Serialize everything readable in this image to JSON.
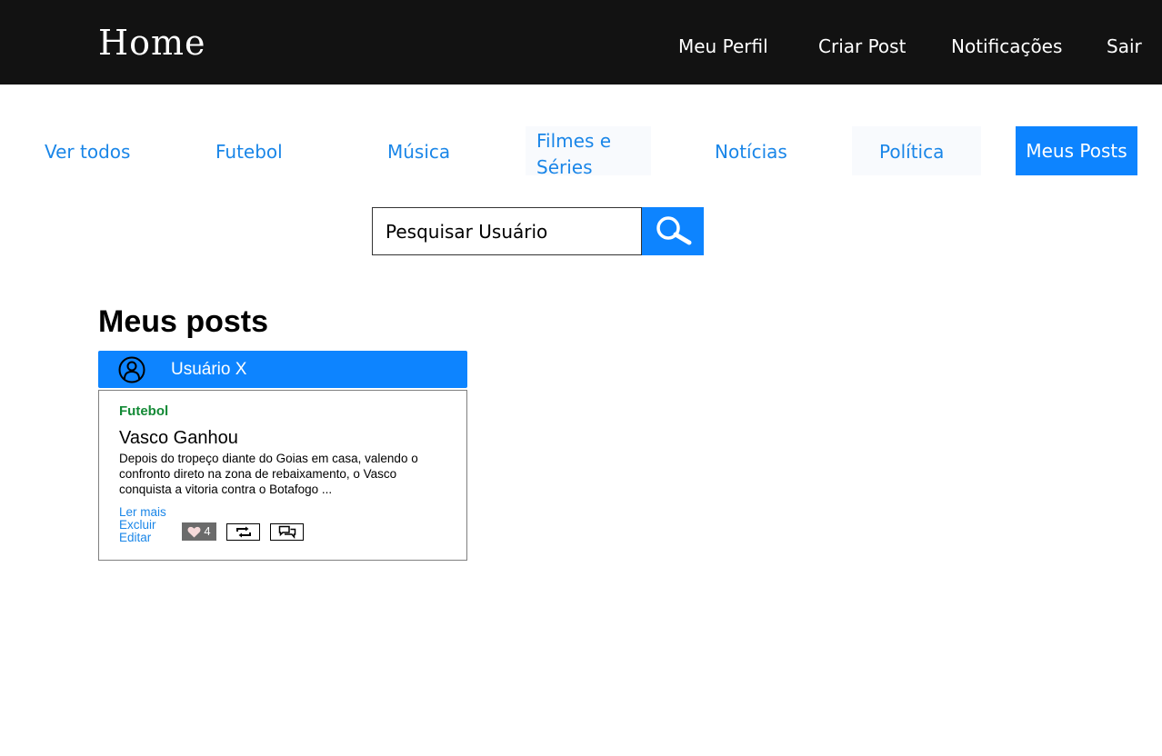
{
  "header": {
    "brand": "Home",
    "nav": [
      "Meu Perfil",
      "Criar Post",
      "Notificações",
      "Sair"
    ]
  },
  "categories": {
    "items": [
      "Ver todos",
      "Futebol",
      "Música",
      "Filmes e Séries",
      "Notícias",
      "Política",
      "Meus Posts"
    ],
    "active": "Meus Posts"
  },
  "search": {
    "placeholder": "Pesquisar Usuário"
  },
  "section": {
    "title": "Meus posts"
  },
  "post": {
    "author": "Usuário X",
    "category": "Futebol",
    "title": "Vasco Ganhou",
    "excerpt": "Depois do tropeço diante do Goias em casa, valendo o confronto direto na zona de rebaixamento, o Vasco conquista a vitoria contra o Botafogo ...",
    "actions": {
      "read_more": "Ler mais",
      "delete": "Excluir",
      "edit": "Editar"
    },
    "likes": "4"
  },
  "colors": {
    "topbar": "#121212",
    "accent": "#0d84ff",
    "link": "#1a86e8",
    "category_text": "#138a36"
  },
  "icons": [
    "search-icon",
    "avatar-icon",
    "heart-icon",
    "repost-icon",
    "comments-icon"
  ]
}
